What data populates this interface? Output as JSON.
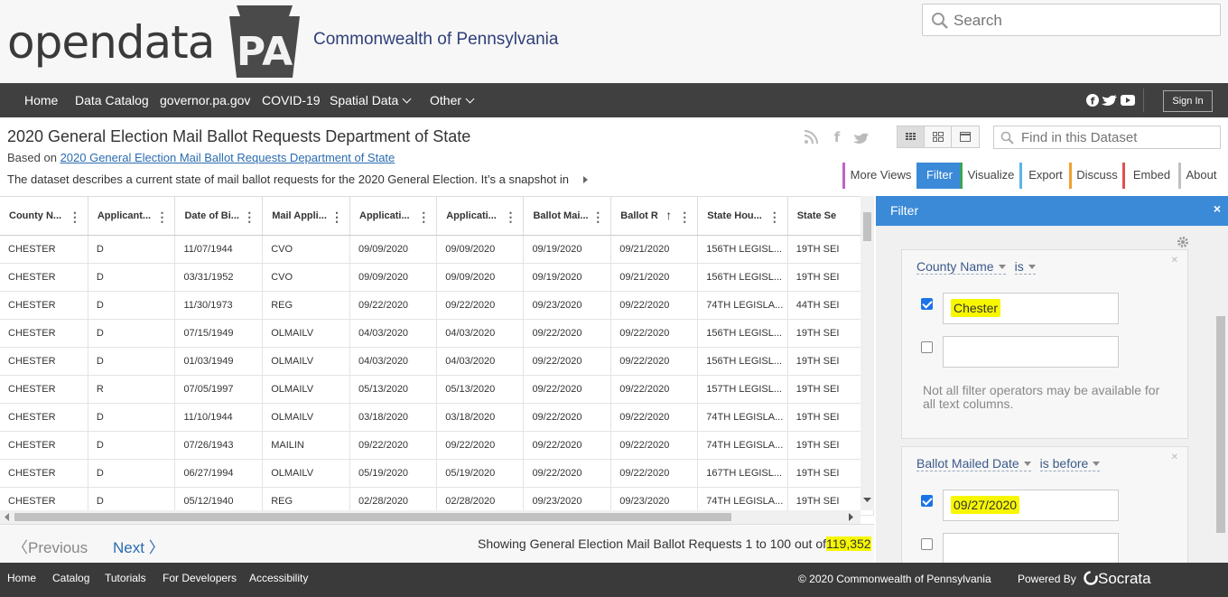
{
  "brand": {
    "logo_text": "opendata",
    "logo_badge": "PA",
    "tagline": "Commonwealth of Pennsylvania"
  },
  "search": {
    "placeholder": "Search"
  },
  "nav": {
    "items": [
      "Home",
      "Data Catalog",
      "governor.pa.gov",
      "COVID-19",
      "Spatial Data",
      "Other"
    ],
    "sign_in": "Sign In"
  },
  "dataset": {
    "title": "2020 General Election Mail Ballot Requests Department of State",
    "based_on_prefix": "Based on",
    "based_on_link": "2020 General Election Mail Ballot Requests Department of State",
    "description": "The dataset describes a current state of mail ballot requests for the 2020 General Election. It’s a snapshot in",
    "find_placeholder": "Find in this Dataset"
  },
  "tabs": [
    {
      "label": "More Views",
      "color": "#c061cb"
    },
    {
      "label": "Filter",
      "color": "#3b8ad8"
    },
    {
      "label": "Visualize",
      "color": "#3aa35a"
    },
    {
      "label": "Export",
      "color": "#5ab4e5"
    },
    {
      "label": "Discuss",
      "color": "#f0a030"
    },
    {
      "label": "Embed",
      "color": "#e05050"
    },
    {
      "label": "About",
      "color": "#c0c0c0"
    }
  ],
  "grid": {
    "columns": [
      "County N...",
      "Applicant...",
      "Date of Bi...",
      "Mail Appli...",
      "Applicati...",
      "Applicati...",
      "Ballot Mai...",
      "Ballot R",
      "State Hou...",
      "State Se"
    ],
    "rows": [
      [
        "CHESTER",
        "D",
        "11/07/1944",
        "CVO",
        "09/09/2020",
        "09/09/2020",
        "09/19/2020",
        "09/21/2020",
        "156TH LEGISL...",
        "19TH SEI"
      ],
      [
        "CHESTER",
        "D",
        "03/31/1952",
        "CVO",
        "09/09/2020",
        "09/09/2020",
        "09/19/2020",
        "09/21/2020",
        "156TH LEGISL...",
        "19TH SEI"
      ],
      [
        "CHESTER",
        "D",
        "11/30/1973",
        "REG",
        "09/22/2020",
        "09/22/2020",
        "09/23/2020",
        "09/22/2020",
        "74TH LEGISLA...",
        "44TH SEI"
      ],
      [
        "CHESTER",
        "D",
        "07/15/1949",
        "OLMAILV",
        "04/03/2020",
        "04/03/2020",
        "09/22/2020",
        "09/22/2020",
        "156TH LEGISL...",
        "19TH SEI"
      ],
      [
        "CHESTER",
        "D",
        "01/03/1949",
        "OLMAILV",
        "04/03/2020",
        "04/03/2020",
        "09/22/2020",
        "09/22/2020",
        "156TH LEGISL...",
        "19TH SEI"
      ],
      [
        "CHESTER",
        "R",
        "07/05/1997",
        "OLMAILV",
        "05/13/2020",
        "05/13/2020",
        "09/22/2020",
        "09/22/2020",
        "157TH LEGISL...",
        "19TH SEI"
      ],
      [
        "CHESTER",
        "D",
        "11/10/1944",
        "OLMAILV",
        "03/18/2020",
        "03/18/2020",
        "09/22/2020",
        "09/22/2020",
        "74TH LEGISLA...",
        "19TH SEI"
      ],
      [
        "CHESTER",
        "D",
        "07/26/1943",
        "MAILIN",
        "09/22/2020",
        "09/22/2020",
        "09/22/2020",
        "09/22/2020",
        "74TH LEGISLA...",
        "19TH SEI"
      ],
      [
        "CHESTER",
        "D",
        "06/27/1994",
        "OLMAILV",
        "05/19/2020",
        "05/19/2020",
        "09/22/2020",
        "09/22/2020",
        "167TH LEGISL...",
        "19TH SEI"
      ],
      [
        "CHESTER",
        "D",
        "05/12/1940",
        "REG",
        "02/28/2020",
        "02/28/2020",
        "09/23/2020",
        "09/23/2020",
        "74TH LEGISLA...",
        "19TH SEI"
      ]
    ]
  },
  "pager": {
    "previous": "Previous",
    "next": "Next",
    "showing": "Showing General Election Mail Ballot Requests 1 to 100 out of",
    "total": "119,352"
  },
  "filter": {
    "title": "Filter",
    "close": "×",
    "conditions": [
      {
        "column": "County Name",
        "operator": "is",
        "values": [
          {
            "checked": true,
            "text": "Chester"
          },
          {
            "checked": false,
            "text": ""
          }
        ]
      },
      {
        "column": "Ballot Mailed Date",
        "operator": "is before",
        "values": [
          {
            "checked": true,
            "text": "09/27/2020"
          },
          {
            "checked": false,
            "text": ""
          }
        ]
      }
    ],
    "note": "Not all filter operators may be available for all text columns."
  },
  "footer": {
    "links": [
      "Home",
      "Catalog",
      "Tutorials",
      "For Developers",
      "Accessibility"
    ],
    "copyright": "© 2020 Commonwealth of Pennsylvania",
    "powered_by": "Powered By",
    "socrata": "Socrata"
  }
}
